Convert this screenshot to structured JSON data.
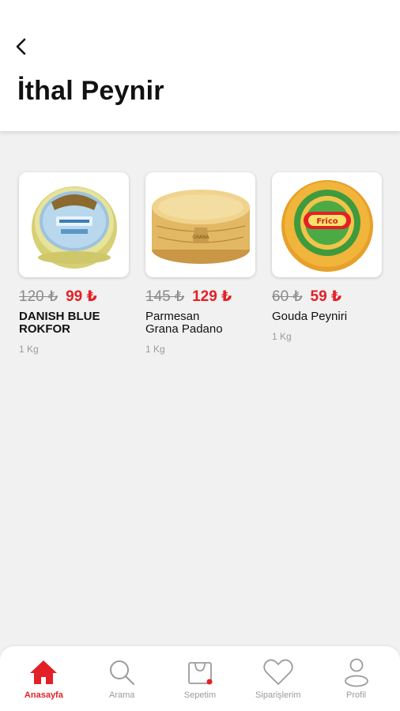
{
  "header": {
    "title": "İthal Peynir"
  },
  "products": [
    {
      "old_price": "120 ₺",
      "new_price": "99 ₺",
      "name": "DANISH BLUE\nROKFOR",
      "unit": "1 Kg"
    },
    {
      "old_price": "145 ₺",
      "new_price": "129 ₺",
      "name": "Parmesan\nGrana Padano",
      "unit": "1 Kg"
    },
    {
      "old_price": "60 ₺",
      "new_price": "59 ₺",
      "name": "Gouda Peyniri",
      "unit": "1 Kg"
    }
  ],
  "nav": {
    "items": [
      {
        "label": "Anasayfa",
        "icon": "home-icon",
        "active": true
      },
      {
        "label": "Arama",
        "icon": "search-icon",
        "active": false
      },
      {
        "label": "Sepetim",
        "icon": "cart-icon",
        "active": false
      },
      {
        "label": "Siparişlerim",
        "icon": "heart-icon",
        "active": false
      },
      {
        "label": "Profil",
        "icon": "profile-icon",
        "active": false
      }
    ]
  },
  "colors": {
    "accent": "#e32027",
    "background": "#f1f1f1",
    "muted": "#9b9b9b"
  }
}
